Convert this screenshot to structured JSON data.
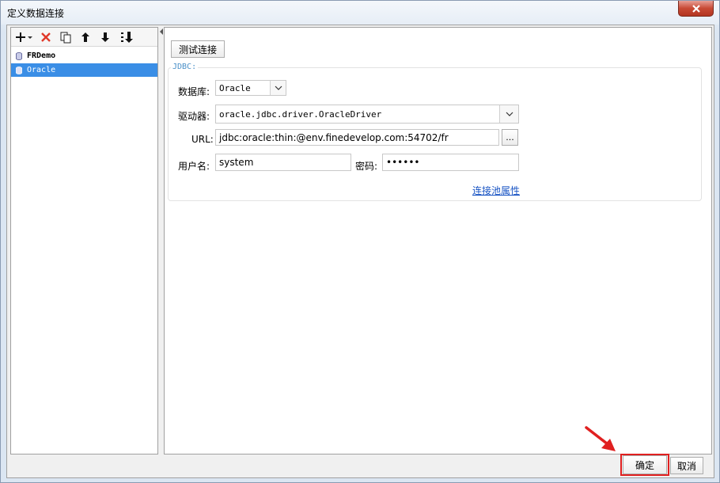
{
  "window": {
    "title": "定义数据连接"
  },
  "toolbar": {
    "icons": [
      "add-icon",
      "delete-icon",
      "copy-icon",
      "move-up-icon",
      "move-down-icon",
      "sort-icon"
    ]
  },
  "connections": [
    {
      "name": "FRDemo",
      "selected": false
    },
    {
      "name": "Oracle",
      "selected": true
    }
  ],
  "main": {
    "test_button": "测试连接",
    "group_title": "JDBC:",
    "database_label": "数据库:",
    "database_value": "Oracle",
    "driver_label": "驱动器:",
    "driver_value": "oracle.jdbc.driver.OracleDriver",
    "url_label": "URL:",
    "url_value": "jdbc:oracle:thin:@env.finedevelop.com:54702/fr",
    "browse_button": "...",
    "username_label": "用户名:",
    "username_value": "system",
    "password_label": "密码:",
    "password_value": "••••••",
    "pool_link": "连接池属性"
  },
  "footer": {
    "ok_label": "确定",
    "cancel_label": "取消"
  },
  "colors": {
    "selection": "#3a8ee6",
    "link": "#1a55c4",
    "highlight": "#e02020",
    "group_title": "#4a90c8"
  }
}
